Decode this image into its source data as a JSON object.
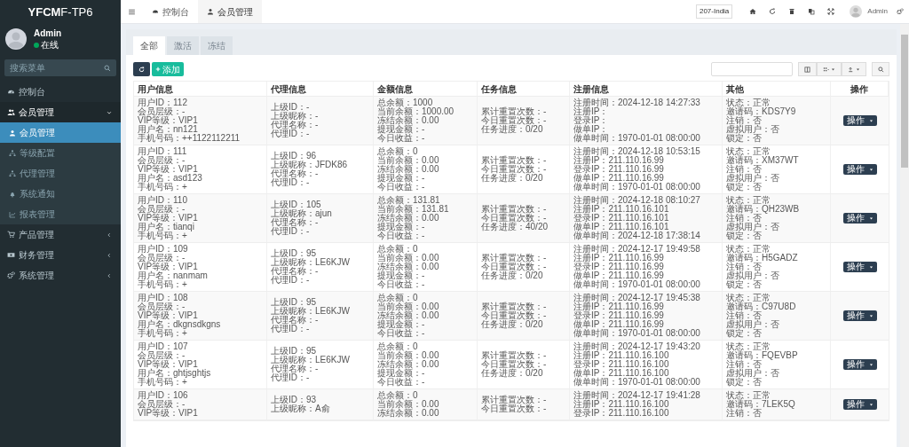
{
  "sidebar": {
    "logo": {
      "bold": "YFCM",
      "rest": "F-TP6"
    },
    "user": {
      "name": "Admin",
      "status": "在线"
    },
    "search": {
      "placeholder": "搜索菜单"
    },
    "menu": [
      {
        "label": "控制台",
        "kind": "dashboard"
      },
      {
        "label": "会员管理",
        "kind": "users",
        "expanded": true,
        "children": [
          {
            "label": "会员管理",
            "kind": "user",
            "selected": true
          },
          {
            "label": "等级配置",
            "kind": "sitemap",
            "selected": false
          },
          {
            "label": "代理管理",
            "kind": "sitemap",
            "selected": false
          },
          {
            "label": "系统通知",
            "kind": "bell",
            "selected": false
          },
          {
            "label": "报表管理",
            "kind": "chart",
            "selected": false
          }
        ]
      },
      {
        "label": "产品管理",
        "kind": "cart",
        "expanded": false
      },
      {
        "label": "财务管理",
        "kind": "money",
        "expanded": false
      },
      {
        "label": "系统管理",
        "kind": "gears",
        "expanded": false
      }
    ]
  },
  "header": {
    "tabs": [
      {
        "label": "控制台",
        "kind": "dashboard",
        "selected": false
      },
      {
        "label": "会员管理",
        "kind": "user",
        "selected": true
      }
    ],
    "region": "207-India",
    "user": "Admin"
  },
  "filter_tabs": [
    {
      "label": "全部",
      "selected": true
    },
    {
      "label": "激活",
      "selected": false
    },
    {
      "label": "冻结",
      "selected": false
    }
  ],
  "toolbar": {
    "add": "添加"
  },
  "table": {
    "columns": [
      "用户信息",
      "代理信息",
      "金额信息",
      "任务信息",
      "注册信息",
      "其他",
      "操作"
    ],
    "rows": [
      {
        "cells": [
          [
            "用户ID：112",
            "会员层级：-",
            "VIP等级：VIP1",
            "用户名：nn121",
            "手机号码：++1122112211"
          ],
          [
            "上级ID：-",
            "上级昵称：-",
            "代理名称：-",
            "代理ID：-"
          ],
          [
            "总余额：1000",
            "当前余额：1000.00",
            "冻结余额：0.00",
            "提现金额：-",
            "今日收益：-"
          ],
          [
            "累计重置次数：-",
            "今日重置次数：-",
            "任务进度：0/20"
          ],
          [
            "注册时间：2024-12-18 14:27:33",
            "注册IP：",
            "登录IP：",
            "做单IP：",
            "做单时间：1970-01-01 08:00:00"
          ],
          [
            "状态：正常",
            "邀请码：KDS7Y9",
            "注销：否",
            "虚拟用户：否",
            "锁定：否"
          ]
        ],
        "action": "操作"
      },
      {
        "cells": [
          [
            "用户ID：111",
            "会员层级：-",
            "VIP等级：VIP1",
            "用户名：asd123",
            "手机号码：+"
          ],
          [
            "上级ID：96",
            "上级昵称：JFDK86",
            "代理名称：-",
            "代理ID：-"
          ],
          [
            "总余额：0",
            "当前余额：0.00",
            "冻结余额：0.00",
            "提现金额：-",
            "今日收益：-"
          ],
          [
            "累计重置次数：-",
            "今日重置次数：-",
            "任务进度：0/20"
          ],
          [
            "注册时间：2024-12-18 10:53:15",
            "注册IP：211.110.16.99",
            "登录IP：211.110.16.99",
            "做单IP：211.110.16.99",
            "做单时间：1970-01-01 08:00:00"
          ],
          [
            "状态：正常",
            "邀请码：XM37WT",
            "注销：否",
            "虚拟用户：否",
            "锁定：否"
          ]
        ],
        "action": "操作"
      },
      {
        "cells": [
          [
            "用户ID：110",
            "会员层级：-",
            "VIP等级：VIP1",
            "用户名：tianqi",
            "手机号码：+"
          ],
          [
            "上级ID：105",
            "上级昵称：ajun",
            "代理名称：-",
            "代理ID：-"
          ],
          [
            "总余额：131.81",
            "当前余额：131.81",
            "冻结余额：0.00",
            "提现金额：-",
            "今日收益：-"
          ],
          [
            "累计重置次数：-",
            "今日重置次数：-",
            "任务进度：40/20"
          ],
          [
            "注册时间：2024-12-18 08:10:27",
            "注册IP：211.110.16.101",
            "登录IP：211.110.16.101",
            "做单IP：211.110.16.101",
            "做单时间：2024-12-18 17:38:14"
          ],
          [
            "状态：正常",
            "邀请码：QH23WB",
            "注销：否",
            "虚拟用户：否",
            "锁定：否"
          ]
        ],
        "action": "操作"
      },
      {
        "cells": [
          [
            "用户ID：109",
            "会员层级：-",
            "VIP等级：VIP1",
            "用户名：nanmam",
            "手机号码：+"
          ],
          [
            "上级ID：95",
            "上级昵称：LE6KJW",
            "代理名称：-",
            "代理ID：-"
          ],
          [
            "总余额：0",
            "当前余额：0.00",
            "冻结余额：0.00",
            "提现金额：-",
            "今日收益：-"
          ],
          [
            "累计重置次数：-",
            "今日重置次数：-",
            "任务进度：0/20"
          ],
          [
            "注册时间：2024-12-17 19:49:58",
            "注册IP：211.110.16.99",
            "登录IP：211.110.16.99",
            "做单IP：211.110.16.99",
            "做单时间：1970-01-01 08:00:00"
          ],
          [
            "状态：正常",
            "邀请码：H5GADZ",
            "注销：否",
            "虚拟用户：否",
            "锁定：否"
          ]
        ],
        "action": "操作"
      },
      {
        "cells": [
          [
            "用户ID：108",
            "会员层级：-",
            "VIP等级：VIP1",
            "用户名：dkgnsdkgns",
            "手机号码：+"
          ],
          [
            "上级ID：95",
            "上级昵称：LE6KJW",
            "代理名称：-",
            "代理ID：-"
          ],
          [
            "总余额：0",
            "当前余额：0.00",
            "冻结余额：0.00",
            "提现金额：-",
            "今日收益：-"
          ],
          [
            "累计重置次数：-",
            "今日重置次数：-",
            "任务进度：0/20"
          ],
          [
            "注册时间：2024-12-17 19:45:38",
            "注册IP：211.110.16.99",
            "登录IP：211.110.16.99",
            "做单IP：211.110.16.99",
            "做单时间：1970-01-01 08:00:00"
          ],
          [
            "状态：正常",
            "邀请码：C97U8D",
            "注销：否",
            "虚拟用户：否",
            "锁定：否"
          ]
        ],
        "action": "操作"
      },
      {
        "cells": [
          [
            "用户ID：107",
            "会员层级：-",
            "VIP等级：VIP1",
            "用户名：ghtjsghtjs",
            "手机号码：+"
          ],
          [
            "上级ID：95",
            "上级昵称：LE6KJW",
            "代理名称：-",
            "代理ID：-"
          ],
          [
            "总余额：0",
            "当前余额：0.00",
            "冻结余额：0.00",
            "提现金额：-",
            "今日收益：-"
          ],
          [
            "累计重置次数：-",
            "今日重置次数：-",
            "任务进度：0/20"
          ],
          [
            "注册时间：2024-12-17 19:43:20",
            "注册IP：211.110.16.100",
            "登录IP：211.110.16.100",
            "做单IP：211.110.16.100",
            "做单时间：1970-01-01 08:00:00"
          ],
          [
            "状态：正常",
            "邀请码：FQEVBP",
            "注销：否",
            "虚拟用户：否",
            "锁定：否"
          ]
        ],
        "action": "操作"
      },
      {
        "cells": [
          [
            "用户ID：106",
            "会员层级：-",
            "VIP等级：VIP1"
          ],
          [
            "上级ID：93",
            "上级昵称：A俞"
          ],
          [
            "总余额：0",
            "当前余额：0.00",
            "冻结余额：0.00"
          ],
          [
            "累计重置次数：-",
            "今日重置次数：-"
          ],
          [
            "注册时间：2024-12-17 19:41:28",
            "注册IP：211.110.16.100",
            "登录IP：211.110.16.100"
          ],
          [
            "状态：正常",
            "邀请码：7LEK5Q",
            "注销：否"
          ]
        ],
        "action": "操作"
      }
    ]
  }
}
